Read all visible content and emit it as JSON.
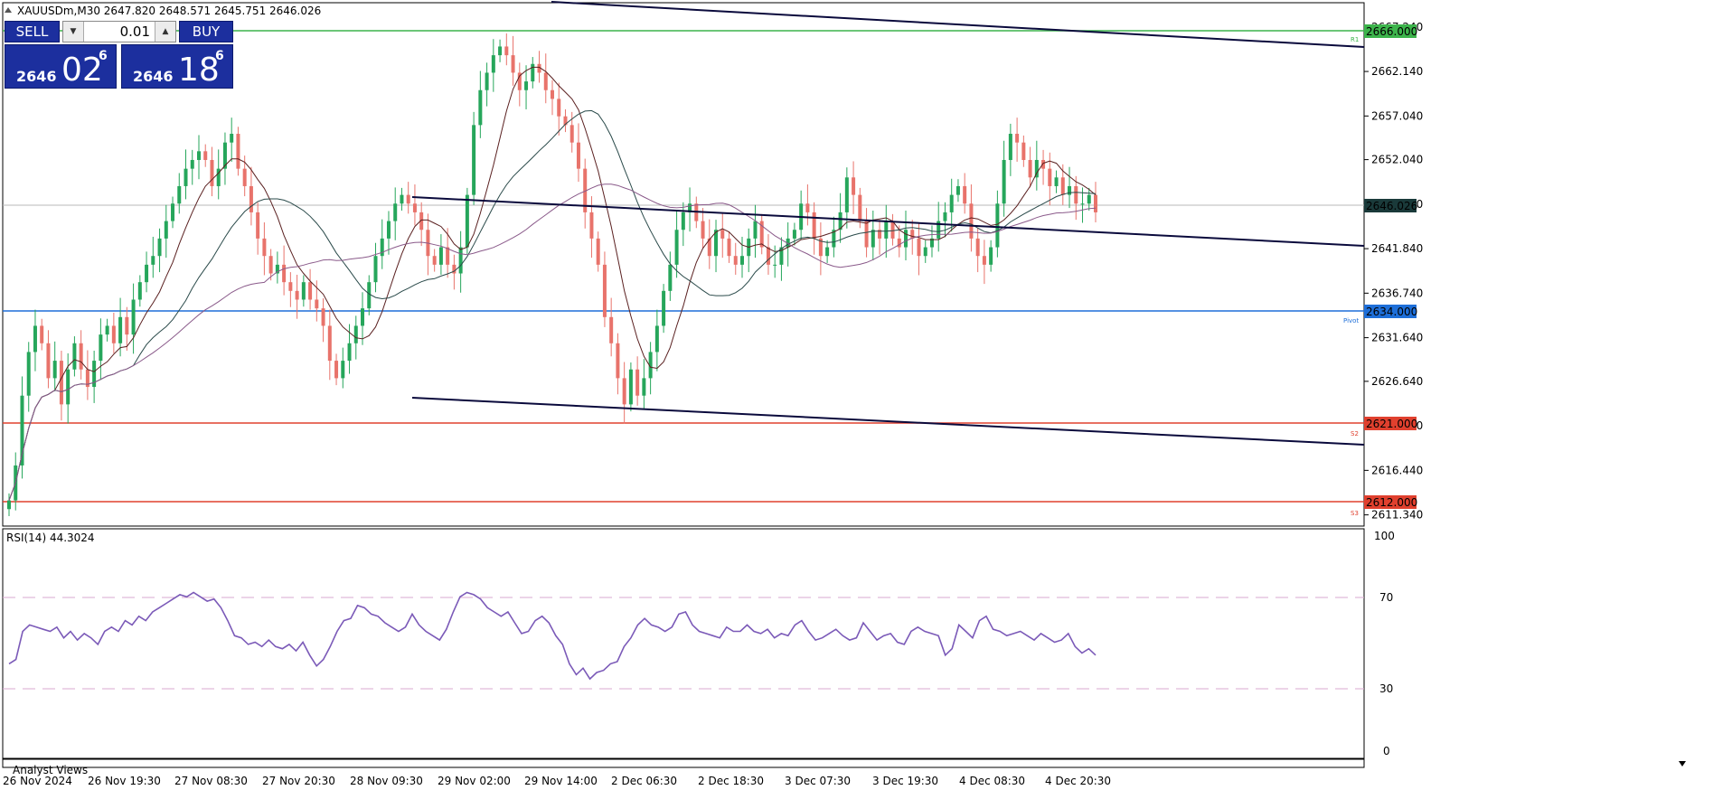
{
  "window": {
    "symbol_info": "XAUUSDm,M30  2647.820 2648.571 2645.751 2646.026"
  },
  "trade_panel": {
    "sell_label": "SELL",
    "buy_label": "BUY",
    "lot_value": "0.01",
    "sell_price_small": "2646",
    "sell_price_big": "02",
    "sell_price_sup": "6",
    "buy_price_small": "2646",
    "buy_price_big": "18",
    "buy_price_sup": "6",
    "down_icon": "triangle-down-icon",
    "up_icon": "triangle-up-icon"
  },
  "indicator": {
    "label": "RSI(14) 44.3024",
    "levels": [
      "100",
      "70",
      "30",
      "0"
    ]
  },
  "analyst_views": "Analyst Views",
  "price_axis": {
    "ticks": [
      "2667.240",
      "2662.140",
      "2657.040",
      "2652.040",
      "2646.940",
      "2641.840",
      "2636.740",
      "2631.640",
      "2626.640",
      "2621.540",
      "2616.440",
      "2611.340"
    ],
    "current_price": "2646.026",
    "level_tags": [
      {
        "price": "2666.000",
        "color": "#3cb44b",
        "text_color": "#ffffff"
      },
      {
        "price": "2634.000",
        "color": "#1e6fd9",
        "text_color": "#ffffff"
      },
      {
        "price": "2621.000",
        "color": "#e0402e",
        "text_color": "#ffffff"
      },
      {
        "price": "2612.000",
        "color": "#e0402e",
        "text_color": "#ffffff"
      }
    ],
    "level_labels": [
      "R1",
      "Pivot",
      "S2",
      "S3"
    ]
  },
  "time_axis": [
    "26 Nov 2024",
    "26 Nov 19:30",
    "27 Nov 08:30",
    "27 Nov 20:30",
    "28 Nov 09:30",
    "29 Nov 02:00",
    "29 Nov 14:00",
    "2 Dec 06:30",
    "2 Dec 18:30",
    "3 Dec 07:30",
    "3 Dec 19:30",
    "4 Dec 08:30",
    "4 Dec 20:30"
  ],
  "colors": {
    "bull": "#26a65b",
    "bear": "#e8736b",
    "rsi": "#7b5ab8",
    "trendline": "#0a0a3c",
    "current_tag_bg": "#1a3a3a"
  },
  "chart_data": {
    "type": "candlestick",
    "price_range": [
      2611.3,
      2669.5
    ],
    "rsi_range": [
      0,
      100
    ],
    "horizontal_levels": [
      2666.0,
      2634.0,
      2621.0,
      2612.0
    ],
    "close_series": [
      2613,
      2617,
      2625,
      2630,
      2633,
      2631,
      2627,
      2629,
      2624,
      2628,
      2631,
      2628,
      2626,
      2629,
      2632,
      2633,
      2631,
      2634,
      2632,
      2636,
      2638,
      2640,
      2641,
      2643,
      2645,
      2647,
      2649,
      2651,
      2652,
      2653,
      2652,
      2649,
      2651,
      2654,
      2655,
      2651,
      2649,
      2646,
      2643,
      2641,
      2639,
      2640,
      2638,
      2637,
      2636,
      2638,
      2636,
      2635,
      2633,
      2629,
      2627,
      2629,
      2631,
      2633,
      2635,
      2638,
      2641,
      2643,
      2645,
      2647,
      2648,
      2647,
      2646,
      2644,
      2641,
      2640,
      2642,
      2640,
      2639,
      2642,
      2648,
      2656,
      2660,
      2662,
      2664,
      2665,
      2664,
      2662,
      2660,
      2661,
      2663,
      2662,
      2660,
      2659,
      2657,
      2656,
      2654,
      2651,
      2646,
      2643,
      2640,
      2634,
      2631,
      2627,
      2624,
      2628,
      2625,
      2627,
      2630,
      2633,
      2637,
      2640,
      2644,
      2646,
      2647,
      2645,
      2643,
      2641,
      2644,
      2643,
      2641,
      2640,
      2641,
      2643,
      2645,
      2642,
      2640,
      2640,
      2642,
      2643,
      2644,
      2647,
      2646,
      2643,
      2641,
      2642,
      2644,
      2646,
      2650,
      2648,
      2645,
      2642,
      2644,
      2643,
      2645,
      2643,
      2642,
      2644,
      2643,
      2641,
      2642,
      2643,
      2645,
      2646,
      2648,
      2649,
      2647,
      2643,
      2641,
      2640,
      2642,
      2647,
      2652,
      2655,
      2654,
      2652,
      2650,
      2652,
      2651,
      2649,
      2650,
      2648,
      2649,
      2647,
      2647,
      2648,
      2646
    ],
    "rsi_series": [
      40,
      42,
      55,
      58,
      57,
      56,
      55,
      57,
      52,
      55,
      51,
      54,
      52,
      49,
      55,
      57,
      55,
      60,
      58,
      62,
      60,
      64,
      66,
      68,
      70,
      72,
      71,
      73,
      71,
      69,
      70,
      66,
      60,
      53,
      52,
      49,
      50,
      48,
      51,
      48,
      47,
      49,
      46,
      50,
      44,
      39,
      42,
      48,
      55,
      60,
      61,
      67,
      66,
      63,
      62,
      59,
      57,
      55,
      57,
      63,
      58,
      55,
      53,
      51,
      56,
      64,
      71,
      73,
      72,
      70,
      66,
      64,
      62,
      64,
      59,
      54,
      55,
      60,
      62,
      59,
      53,
      49,
      40,
      35,
      38,
      33,
      36,
      37,
      40,
      41,
      48,
      52,
      58,
      61,
      58,
      57,
      55,
      57,
      63,
      64,
      58,
      55,
      54,
      53,
      52,
      57,
      55,
      55,
      58,
      55,
      54,
      56,
      52,
      54,
      53,
      58,
      60,
      55,
      51,
      52,
      54,
      56,
      53,
      51,
      52,
      59,
      55,
      51,
      53,
      54,
      50,
      49,
      55,
      57,
      55,
      54,
      53,
      44,
      47,
      58,
      55,
      52,
      60,
      62,
      56,
      55,
      53,
      54,
      55,
      53,
      51,
      54,
      52,
      50,
      51,
      54,
      48,
      45,
      47,
      44
    ]
  }
}
